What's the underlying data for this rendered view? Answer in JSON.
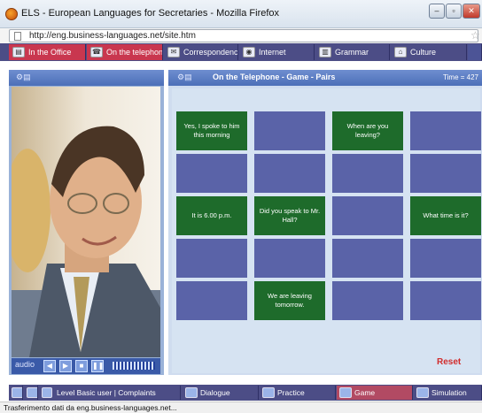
{
  "window": {
    "title": "ELS - European Languages for Secretaries - Mozilla Firefox"
  },
  "address_bar": {
    "url": "http://eng.business-languages.net/site.htm"
  },
  "top_nav": {
    "items": [
      {
        "label": "In the Office",
        "icon": "office-icon"
      },
      {
        "label": "On the telephone",
        "icon": "telephone-icon"
      },
      {
        "label": "Correspondence",
        "icon": "envelope-icon"
      },
      {
        "label": "Internet",
        "icon": "globe-icon"
      },
      {
        "label": "Grammar",
        "icon": "books-icon"
      },
      {
        "label": "Culture",
        "icon": "hat-icon"
      }
    ]
  },
  "audio": {
    "label": "audio"
  },
  "game": {
    "title": "On the Telephone - Game - Pairs",
    "time": "Time = 427",
    "cards": [
      "Yes, I spoke to him this morning",
      "",
      "When are you leaving?",
      "",
      "",
      "",
      "",
      "",
      "It is 6.00 p.m.",
      "Did you speak to Mr. Hall?",
      "",
      "What time is it?",
      "",
      "",
      "",
      "",
      "",
      "We are leaving tomorrow.",
      "",
      ""
    ],
    "reset_label": "Reset"
  },
  "bottom_nav": {
    "level": "Level Basic user | Complaints",
    "tabs": [
      "Dialogue",
      "Practice",
      "Game",
      "Simulation"
    ]
  },
  "status": {
    "text": "Trasferimento dati da eng.business-languages.net..."
  },
  "colors": {
    "nav_bg": "#4c4d86",
    "active_tab": "#c9374f",
    "card_face_down": "#5a63a8",
    "card_face_up": "#1e6b2b",
    "reset": "#d12c2c"
  }
}
